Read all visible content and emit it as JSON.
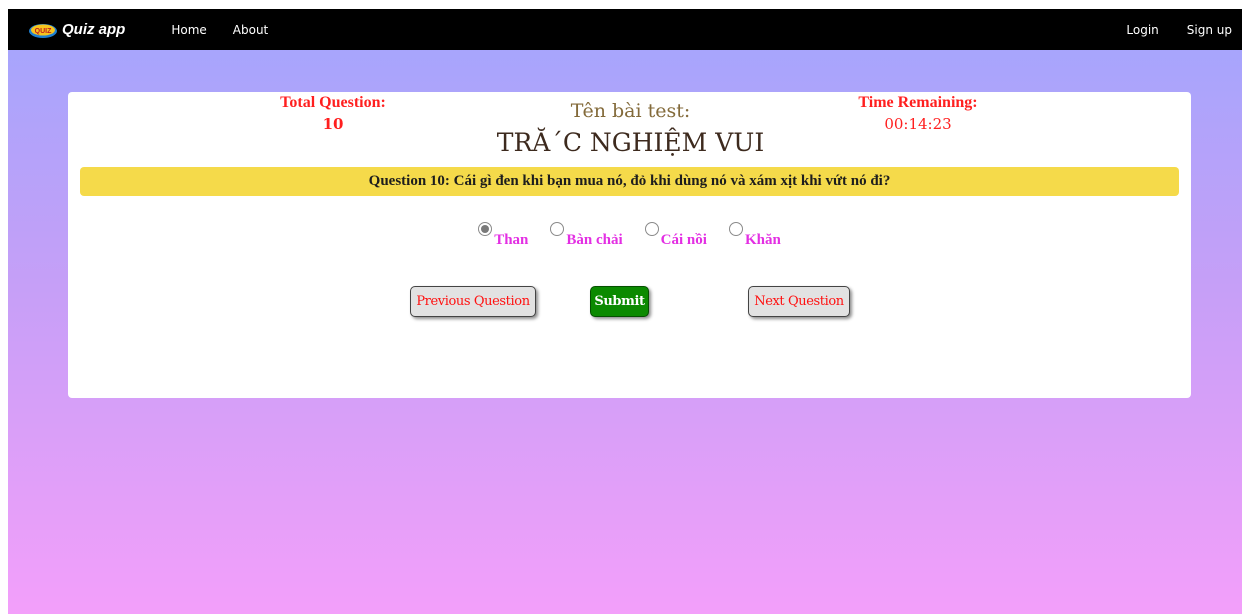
{
  "nav": {
    "brand_logo_text": "QUIZ",
    "brand": "Quiz app",
    "home": "Home",
    "about": "About",
    "login": "Login",
    "signup": "Sign up"
  },
  "quiz": {
    "total_label": "Total Question:",
    "total_value": "10",
    "test_label": "Tên bài test:",
    "test_name": "TRĂ´C NGHIỆM VUI",
    "time_label": "Time Remaining:",
    "time_value": "00:14:23",
    "question": "Question 10: Cái gì đen khi bạn mua nó, đỏ khi dùng nó và xám xịt khi vứt nó đi?",
    "options": [
      {
        "label": "Than",
        "checked": true
      },
      {
        "label": "Bàn chải",
        "checked": false
      },
      {
        "label": "Cái nồi",
        "checked": false
      },
      {
        "label": "Khăn",
        "checked": false
      }
    ],
    "prev_label": "Previous Question",
    "submit_label": "Submit",
    "next_label": "Next Question"
  },
  "colors": {
    "gradient_top": "#a2a6fd",
    "gradient_bottom": "#f39ffa",
    "question_bar": "#f5da4a",
    "option_text": "#e32fe3",
    "info_red": "#ff1f1f",
    "submit_green": "#0b8a00"
  }
}
